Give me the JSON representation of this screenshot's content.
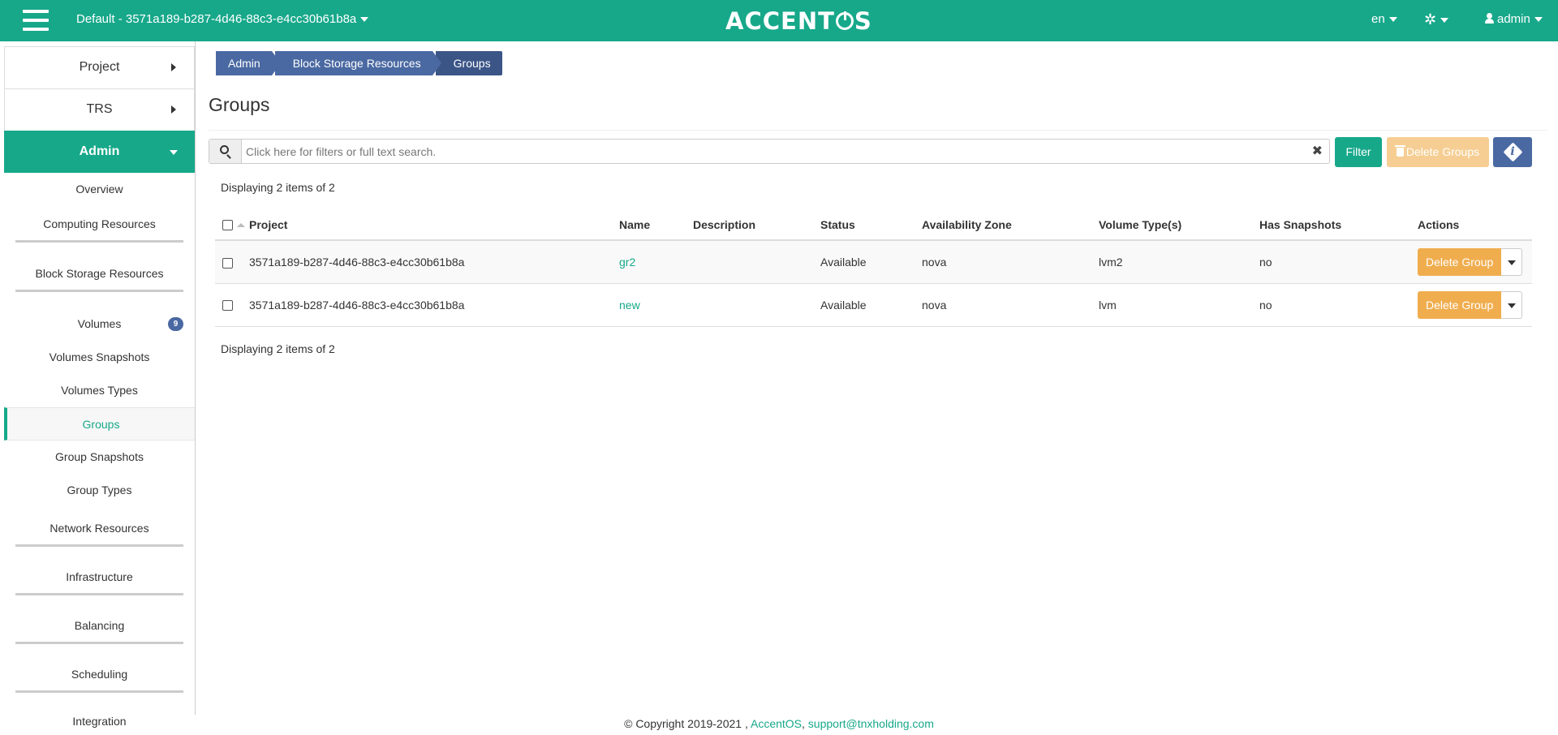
{
  "topbar": {
    "project_selector": "Default - 3571a189-b287-4d46-88c3-e4cc30b61b8a",
    "logo_left": "ACCENT",
    "logo_right": "S",
    "language": "en",
    "user": "admin",
    "color": "#17a88a"
  },
  "sidebar": {
    "project": "Project",
    "trs": "TRS",
    "admin": "Admin",
    "overview": "Overview",
    "computing": "Computing Resources",
    "block_storage": "Block Storage Resources",
    "volumes": "Volumes",
    "volumes_badge": "9",
    "volumes_snapshots": "Volumes Snapshots",
    "volumes_types": "Volumes Types",
    "groups": "Groups",
    "group_snapshots": "Group Snapshots",
    "group_types": "Group Types",
    "network": "Network Resources",
    "infrastructure": "Infrastructure",
    "balancing": "Balancing",
    "scheduling": "Scheduling",
    "integration": "Integration"
  },
  "breadcrumb": {
    "admin": "Admin",
    "block_storage": "Block Storage Resources",
    "groups": "Groups"
  },
  "page": {
    "title": "Groups",
    "search_placeholder": "Click here for filters or full text search.",
    "filter_button": "Filter",
    "delete_groups_button": "Delete Groups",
    "count_top": "Displaying 2 items of 2",
    "count_bottom": "Displaying 2 items of 2"
  },
  "table": {
    "headers": {
      "project": "Project",
      "name": "Name",
      "description": "Description",
      "status": "Status",
      "az": "Availability Zone",
      "volume_types": "Volume Type(s)",
      "has_snapshots": "Has Snapshots",
      "actions": "Actions"
    },
    "rows": [
      {
        "project": "3571a189-b287-4d46-88c3-e4cc30b61b8a",
        "name": "gr2",
        "description": "",
        "status": "Available",
        "az": "nova",
        "volume_types": "lvm2",
        "has_snapshots": "no",
        "action": "Delete Group"
      },
      {
        "project": "3571a189-b287-4d46-88c3-e4cc30b61b8a",
        "name": "new",
        "description": "",
        "status": "Available",
        "az": "nova",
        "volume_types": "lvm",
        "has_snapshots": "no",
        "action": "Delete Group"
      }
    ]
  },
  "footer": {
    "copyright": "© Copyright 2019-2021 ,",
    "accentos": "AccentOS",
    "sep": ",",
    "email": "support@tnxholding.com"
  }
}
